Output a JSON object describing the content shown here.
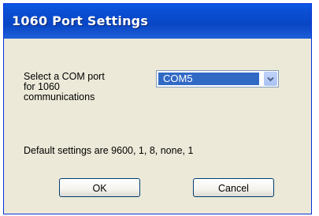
{
  "window": {
    "title": "1060 Port Settings"
  },
  "form": {
    "com_label": "Select a COM port\nfor 1060\ncommunications",
    "com_select": {
      "selected_value": "COM5"
    },
    "defaults_text": "Default settings are 9600,  1, 8, none, 1"
  },
  "buttons": {
    "ok_label": "OK",
    "cancel_label": "Cancel"
  },
  "icons": {
    "dropdown": "chevron-down-icon"
  },
  "colors": {
    "titlebar": "#0846c5",
    "selection": "#316ac5",
    "dialog_bg": "#ece9d8"
  }
}
